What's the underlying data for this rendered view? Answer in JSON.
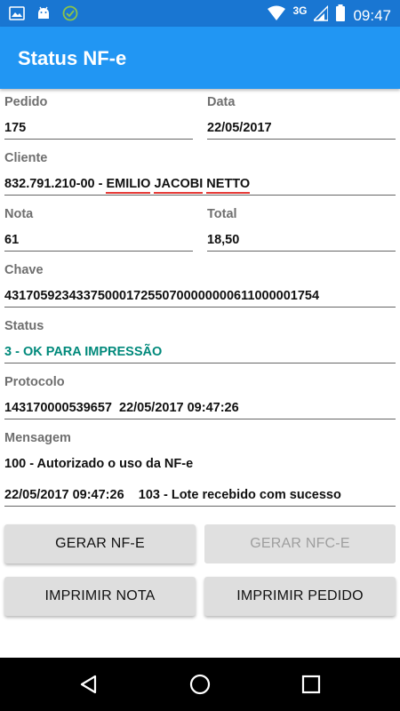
{
  "status_bar": {
    "network": "3G",
    "time": "09:47"
  },
  "app_bar": {
    "title": "Status NF-e"
  },
  "form": {
    "pedido": {
      "label": "Pedido",
      "value": "175"
    },
    "data": {
      "label": "Data",
      "value": "22/05/2017"
    },
    "cliente": {
      "label": "Cliente",
      "prefix": "832.791.210-00 - ",
      "name_parts": [
        "EMILIO",
        "JACOBI",
        "NETTO"
      ]
    },
    "nota": {
      "label": "Nota",
      "value": "61"
    },
    "total": {
      "label": "Total",
      "value": "18,50"
    },
    "chave": {
      "label": "Chave",
      "value": "43170592343375000172550700000000611000001754"
    },
    "status": {
      "label": "Status",
      "value": "3 - OK PARA IMPRESSÃO"
    },
    "protocolo": {
      "label": "Protocolo",
      "value": "143170000539657  22/05/2017 09:47:26"
    },
    "mensagem": {
      "label": "Mensagem",
      "line1": "100 - Autorizado o uso da NF-e",
      "line2": "22/05/2017 09:47:26    103 - Lote recebido com sucesso"
    }
  },
  "buttons": {
    "gerar_nfe": "GERAR NF-E",
    "gerar_nfce": "GERAR NFC-E",
    "imprimir_nota": "IMPRIMIR NOTA",
    "imprimir_pedido": "IMPRIMIR PEDIDO"
  },
  "colors": {
    "status_bar": "#1976d2",
    "app_bar": "#2196f3",
    "accent_status": "#00897b",
    "button_bg": "#dedede"
  }
}
